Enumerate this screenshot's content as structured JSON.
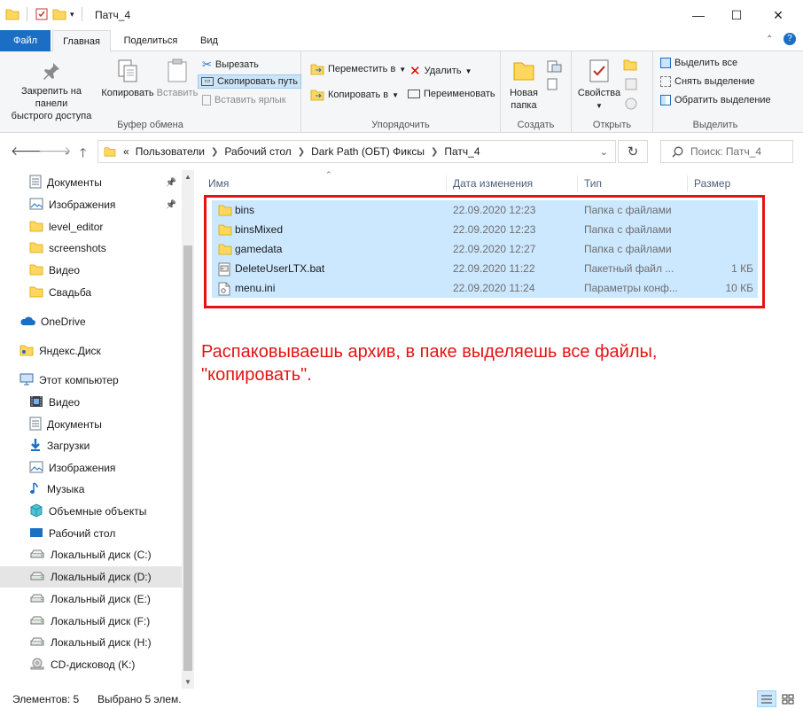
{
  "window": {
    "title": "Патч_4",
    "minimize": "—",
    "maximize": "☐",
    "close": "✕"
  },
  "ribbon_tabs": {
    "file": "Файл",
    "home": "Главная",
    "share": "Поделиться",
    "view": "Вид"
  },
  "ribbon": {
    "clipboard": {
      "label": "Буфер обмена",
      "pin_line1": "Закрепить на панели",
      "pin_line2": "быстрого доступа",
      "copy": "Копировать",
      "paste": "Вставить",
      "cut": "Вырезать",
      "copy_path": "Скопировать путь",
      "paste_shortcut": "Вставить ярлык"
    },
    "organize": {
      "label": "Упорядочить",
      "move_to": "Переместить в",
      "copy_to": "Копировать в",
      "delete": "Удалить",
      "rename": "Переименовать"
    },
    "create": {
      "label": "Создать",
      "new_folder_line1": "Новая",
      "new_folder_line2": "папка"
    },
    "open": {
      "label": "Открыть",
      "properties": "Свойства"
    },
    "select": {
      "label": "Выделить",
      "select_all": "Выделить все",
      "select_none": "Снять выделение",
      "invert": "Обратить выделение"
    }
  },
  "address": {
    "prefix": "«",
    "crumbs": [
      "Пользователи",
      "Рабочий стол",
      "Dark Path (ОБТ) Фиксы",
      "Патч_4"
    ],
    "search_placeholder": "Поиск: Патч_4"
  },
  "nav": {
    "items": [
      {
        "label": "Документы",
        "icon": "documents-icon",
        "pinned": true
      },
      {
        "label": "Изображения",
        "icon": "pictures-icon",
        "pinned": true
      },
      {
        "label": "level_editor",
        "icon": "folder-icon",
        "pinned": false
      },
      {
        "label": "screenshots",
        "icon": "folder-icon",
        "pinned": false
      },
      {
        "label": "Видео",
        "icon": "folder-icon",
        "pinned": false
      },
      {
        "label": "Свадьба",
        "icon": "folder-icon",
        "pinned": false
      },
      {
        "label": "OneDrive",
        "icon": "onedrive-icon",
        "pinned": false
      },
      {
        "label": "Яндекс.Диск",
        "icon": "yandex-disk-icon",
        "pinned": false
      },
      {
        "label": "Этот компьютер",
        "icon": "computer-icon",
        "pinned": false
      },
      {
        "label": "Видео",
        "icon": "video-icon",
        "pinned": false
      },
      {
        "label": "Документы",
        "icon": "documents-icon",
        "pinned": false
      },
      {
        "label": "Загрузки",
        "icon": "downloads-icon",
        "pinned": false
      },
      {
        "label": "Изображения",
        "icon": "pictures-icon",
        "pinned": false
      },
      {
        "label": "Музыка",
        "icon": "music-icon",
        "pinned": false
      },
      {
        "label": "Объемные объекты",
        "icon": "3d-objects-icon",
        "pinned": false
      },
      {
        "label": "Рабочий стол",
        "icon": "desktop-icon",
        "pinned": false
      },
      {
        "label": "Локальный диск (C:)",
        "icon": "drive-icon",
        "pinned": false
      },
      {
        "label": "Локальный диск (D:)",
        "icon": "drive-icon",
        "pinned": false,
        "selected": true
      },
      {
        "label": "Локальный диск (E:)",
        "icon": "drive-icon",
        "pinned": false
      },
      {
        "label": "Локальный диск (F:)",
        "icon": "drive-icon",
        "pinned": false
      },
      {
        "label": "Локальный диск (H:)",
        "icon": "drive-icon",
        "pinned": false
      },
      {
        "label": "CD-дисковод (K:)",
        "icon": "cd-drive-icon",
        "pinned": false
      }
    ]
  },
  "columns": {
    "name": "Имя",
    "date": "Дата изменения",
    "type": "Тип",
    "size": "Размер"
  },
  "files": [
    {
      "name": "bins",
      "date": "22.09.2020 12:23",
      "type": "Папка с файлами",
      "size": "",
      "icon": "folder-icon"
    },
    {
      "name": "binsMixed",
      "date": "22.09.2020 12:23",
      "type": "Папка с файлами",
      "size": "",
      "icon": "folder-icon"
    },
    {
      "name": "gamedata",
      "date": "22.09.2020 12:27",
      "type": "Папка с файлами",
      "size": "",
      "icon": "folder-icon"
    },
    {
      "name": "DeleteUserLTX.bat",
      "date": "22.09.2020 11:22",
      "type": "Пакетный файл ...",
      "size": "1 КБ",
      "icon": "batch-file-icon"
    },
    {
      "name": "menu.ini",
      "date": "22.09.2020 11:24",
      "type": "Параметры конф...",
      "size": "10 КБ",
      "icon": "ini-file-icon"
    }
  ],
  "annotation": "Распаковываешь архив, в паке выделяешь все файлы, \"копировать\".",
  "status": {
    "items": "Элементов: 5",
    "selected": "Выбрано 5 элем."
  },
  "colors": {
    "accent": "#1a6fc4",
    "selection": "#cce8ff",
    "annotation": "#e21414"
  }
}
